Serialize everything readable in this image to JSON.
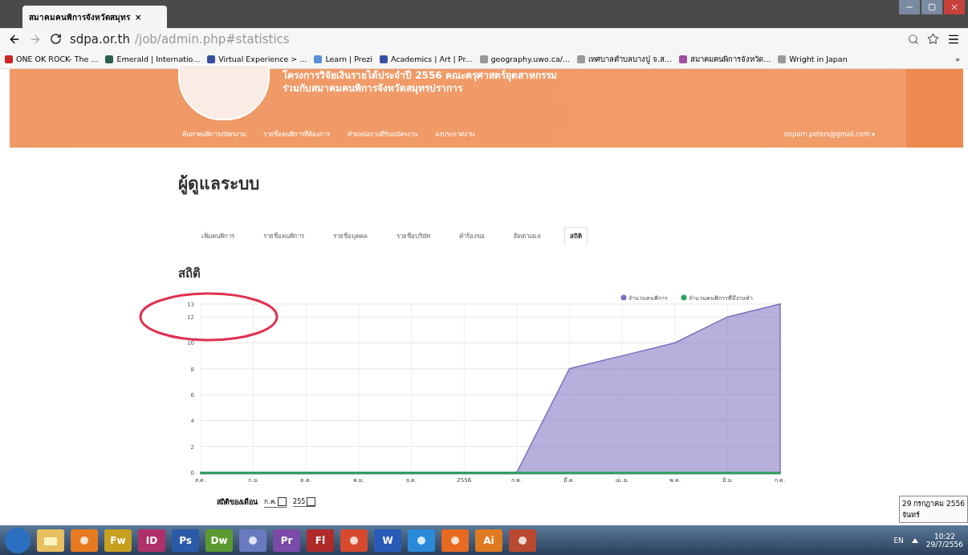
{
  "browser": {
    "tab": {
      "title": "สมาคมคนพิการจังหวัดสมุทร",
      "close": "×"
    },
    "url_host": "sdpa.or.th",
    "url_path": "/job/admin.php#statistics",
    "bookmarks": [
      {
        "label": "ONE OK ROCK- The ...",
        "color": "#cc2222"
      },
      {
        "label": "Emerald | Internatio...",
        "color": "#2f5f4f"
      },
      {
        "label": "Virtual Experience > ...",
        "color": "#3a4fa0"
      },
      {
        "label": "Learn | Prezi",
        "color": "#5a8fd6"
      },
      {
        "label": "Academics | Art | Pr...",
        "color": "#3a4fa0"
      },
      {
        "label": "geography.uwo.ca/...",
        "color": "#999999"
      },
      {
        "label": "เทศบาลตำบลบางปู จ.ส...",
        "color": "#999999"
      },
      {
        "label": "สมาคมคนพิการจังหวัด...",
        "color": "#a04fa0"
      },
      {
        "label": "Wright in Japan",
        "color": "#999999"
      }
    ],
    "more": "»"
  },
  "header": {
    "line1": "โครงการวิจัยเงินรายได้ประจำปี 2556 คณะครุศาสตร์อุตสาหกรรม",
    "line2": "ร่วมกับสมาคมคนพิการจังหวัดสมุทรปราการ",
    "nav": [
      "ค้นหาคนพิการสมัครงาน",
      "รายชื่อคนพิการที่ต้องการ",
      "ตำแหน่งงานที่รับสมัครงาน",
      "ลงประกาศงาน"
    ],
    "user": "sinporn.peters@gmail.com ▾"
  },
  "title": "ผู้ดูแลระบบ",
  "tabs": [
    {
      "label": "เพิ่มคนพิการ",
      "selected": false
    },
    {
      "label": "รายชื่อคนพิการ",
      "selected": false
    },
    {
      "label": "รายชื่อบุคคล",
      "selected": false
    },
    {
      "label": "รายชื่อบริษัท",
      "selected": false
    },
    {
      "label": "คำร้องขอ",
      "selected": false
    },
    {
      "label": "ติดตามผล",
      "selected": false
    },
    {
      "label": "สถิติ",
      "selected": true
    }
  ],
  "section_title": "สถิติ",
  "chart_data": {
    "type": "area",
    "categories": [
      "ส.ค.",
      "ก.ย.",
      "ต.ค.",
      "พ.ย.",
      "ธ.ค.",
      "2556",
      "ก.พ.",
      "มี.ค.",
      "เม.ย.",
      "พ.ค.",
      "มิ.ย.",
      "ก.ค."
    ],
    "series": [
      {
        "name": "จำนวนคนพิการ",
        "color": "#7b6fc0",
        "values": [
          0,
          0,
          0,
          0,
          0,
          0,
          0,
          8,
          9,
          10,
          12,
          13
        ]
      },
      {
        "name": "จำนวนคนพิการที่มีงานทำ",
        "color": "#2e9e5e",
        "values": [
          0,
          0,
          0,
          0,
          0,
          0,
          0,
          0,
          0,
          0,
          0,
          0
        ]
      }
    ],
    "grid": true,
    "legend": "top-right",
    "ylim": [
      0,
      13
    ],
    "yticks": [
      0,
      2,
      4,
      6,
      8,
      10,
      12,
      13
    ]
  },
  "filter": {
    "label": "สถิติของเดือน",
    "month": "ก.ค.",
    "year": "255"
  },
  "taskbar": {
    "apps": [
      {
        "kind": "orb",
        "color": "#2a6fc0"
      },
      {
        "kind": "folder",
        "color": "#e8c060"
      },
      {
        "kind": "plain",
        "color": "#e87a20"
      },
      {
        "kind": "letter",
        "label": "Fw",
        "color": "#c8a020"
      },
      {
        "kind": "letter",
        "label": "ID",
        "color": "#b0306a"
      },
      {
        "kind": "letter",
        "label": "Ps",
        "color": "#2a5aa8"
      },
      {
        "kind": "letter",
        "label": "Dw",
        "color": "#5a9a30"
      },
      {
        "kind": "plain",
        "color": "#6a7ac0"
      },
      {
        "kind": "letter",
        "label": "Pr",
        "color": "#7a4aa8"
      },
      {
        "kind": "letter",
        "label": "Fl",
        "color": "#b02a2a"
      },
      {
        "kind": "plain",
        "color": "#d84a30"
      },
      {
        "kind": "letter",
        "label": "W",
        "color": "#2a5ab8"
      },
      {
        "kind": "plain",
        "color": "#2a8ad8"
      },
      {
        "kind": "plain",
        "color": "#e86a20"
      },
      {
        "kind": "letter",
        "label": "Ai",
        "color": "#e07a20"
      },
      {
        "kind": "plain",
        "color": "#b84a30"
      }
    ],
    "lang": "EN",
    "time": "10:22",
    "date": "29/7/2556",
    "tooltip_date": "29 กรกฎาคม 2556",
    "tooltip_day": "จันทร์"
  }
}
